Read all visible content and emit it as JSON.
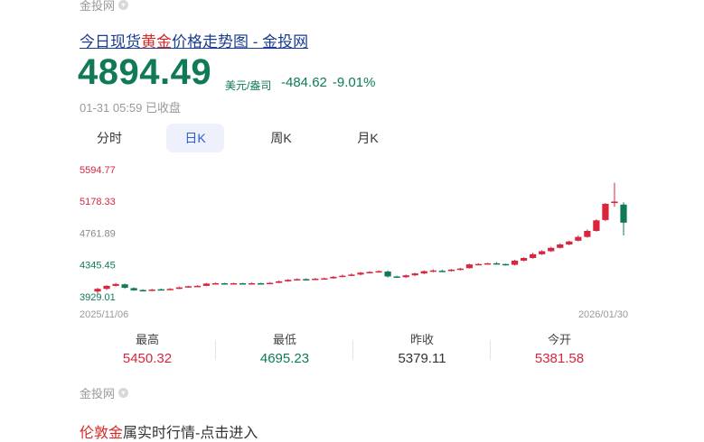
{
  "source": {
    "top": "金投网",
    "bottom": "金投网",
    "icon": "chevron-down-circle-icon"
  },
  "title": {
    "before": "今日现货",
    "highlight": "黄金",
    "after": "价格走势图 - 金投网"
  },
  "quote": {
    "price": "4894.49",
    "unit": "美元/盎司",
    "change": "-484.62",
    "change_pct": "-9.01%",
    "timestamp": "01-31 05:59",
    "status": "已收盘"
  },
  "tabs": [
    {
      "label": "分时"
    },
    {
      "label": "日K",
      "active": true
    },
    {
      "label": "周K"
    },
    {
      "label": "月K"
    }
  ],
  "colors": {
    "up": "#d7263d",
    "down": "#0f7a55",
    "active_tab_bg": "#eef1fb",
    "link": "#1a3d8f"
  },
  "chart_data": {
    "type": "candlestick",
    "y_ticks": [
      "5594.77",
      "5178.33",
      "4761.89",
      "4345.45",
      "3929.01"
    ],
    "x_ticks": [
      "2025/11/06",
      "2026/01/30"
    ],
    "ylim": [
      3929.01,
      5594.77
    ],
    "candles": [
      [
        3975,
        4010,
        3945,
        4025,
        "up"
      ],
      [
        4010,
        4050,
        3995,
        4060,
        "up"
      ],
      [
        4050,
        4075,
        4040,
        4090,
        "up"
      ],
      [
        4070,
        4025,
        4010,
        4080,
        "down"
      ],
      [
        4020,
        3990,
        3985,
        4030,
        "down"
      ],
      [
        3995,
        3985,
        3975,
        4005,
        "down"
      ],
      [
        3985,
        4000,
        3980,
        4010,
        "up"
      ],
      [
        4005,
        3995,
        3990,
        4015,
        "down"
      ],
      [
        4000,
        4010,
        3995,
        4020,
        "up"
      ],
      [
        4010,
        4030,
        4005,
        4040,
        "up"
      ],
      [
        4030,
        4045,
        4025,
        4050,
        "up"
      ],
      [
        4045,
        4050,
        4040,
        4060,
        "up"
      ],
      [
        4050,
        4080,
        4045,
        4090,
        "up"
      ],
      [
        4080,
        4085,
        4070,
        4095,
        "up"
      ],
      [
        4085,
        4080,
        4075,
        4090,
        "down"
      ],
      [
        4080,
        4085,
        4075,
        4092,
        "up"
      ],
      [
        4085,
        4080,
        4070,
        4090,
        "down"
      ],
      [
        4080,
        4085,
        4075,
        4095,
        "up"
      ],
      [
        4085,
        4080,
        4075,
        4090,
        "down"
      ],
      [
        4080,
        4090,
        4075,
        4100,
        "up"
      ],
      [
        4090,
        4110,
        4085,
        4120,
        "up"
      ],
      [
        4110,
        4130,
        4105,
        4140,
        "up"
      ],
      [
        4130,
        4140,
        4120,
        4150,
        "up"
      ],
      [
        4140,
        4135,
        4125,
        4150,
        "down"
      ],
      [
        4135,
        4145,
        4130,
        4155,
        "up"
      ],
      [
        4145,
        4150,
        4140,
        4160,
        "up"
      ],
      [
        4150,
        4170,
        4145,
        4180,
        "up"
      ],
      [
        4170,
        4185,
        4165,
        4200,
        "up"
      ],
      [
        4185,
        4200,
        4180,
        4215,
        "up"
      ],
      [
        4200,
        4225,
        4190,
        4235,
        "up"
      ],
      [
        4225,
        4235,
        4215,
        4245,
        "up"
      ],
      [
        4235,
        4245,
        4225,
        4255,
        "up"
      ],
      [
        4240,
        4175,
        4160,
        4255,
        "down"
      ],
      [
        4175,
        4165,
        4155,
        4185,
        "down"
      ],
      [
        4165,
        4190,
        4155,
        4200,
        "up"
      ],
      [
        4190,
        4215,
        4180,
        4225,
        "up"
      ],
      [
        4215,
        4245,
        4205,
        4255,
        "up"
      ],
      [
        4245,
        4255,
        4230,
        4270,
        "up"
      ],
      [
        4250,
        4245,
        4235,
        4265,
        "down"
      ],
      [
        4250,
        4265,
        4240,
        4275,
        "up"
      ],
      [
        4265,
        4280,
        4255,
        4290,
        "up"
      ],
      [
        4285,
        4335,
        4280,
        4345,
        "up"
      ],
      [
        4335,
        4340,
        4325,
        4350,
        "up"
      ],
      [
        4340,
        4350,
        4330,
        4355,
        "up"
      ],
      [
        4350,
        4345,
        4335,
        4365,
        "down"
      ],
      [
        4340,
        4325,
        4320,
        4345,
        "down"
      ],
      [
        4330,
        4385,
        4320,
        4395,
        "up"
      ],
      [
        4385,
        4420,
        4375,
        4430,
        "up"
      ],
      [
        4420,
        4470,
        4410,
        4490,
        "up"
      ],
      [
        4470,
        4510,
        4460,
        4525,
        "up"
      ],
      [
        4510,
        4555,
        4500,
        4570,
        "up"
      ],
      [
        4555,
        4600,
        4545,
        4615,
        "up"
      ],
      [
        4600,
        4640,
        4590,
        4650,
        "up"
      ],
      [
        4650,
        4700,
        4640,
        4720,
        "up"
      ],
      [
        4700,
        4780,
        4690,
        4800,
        "up"
      ],
      [
        4780,
        4920,
        4770,
        4935,
        "up"
      ],
      [
        4925,
        5140,
        4910,
        5150,
        "up"
      ],
      [
        5150,
        5170,
        5100,
        5420,
        "up"
      ],
      [
        5130,
        4890,
        4720,
        5160,
        "down"
      ]
    ]
  },
  "stats": [
    {
      "label": "最高",
      "value": "5450.32",
      "tone": "up"
    },
    {
      "label": "最低",
      "value": "4695.23",
      "tone": "down"
    },
    {
      "label": "昨收",
      "value": "5379.11",
      "tone": "neutral"
    },
    {
      "label": "今开",
      "value": "5381.58",
      "tone": "up"
    }
  ],
  "link": {
    "highlight": "伦敦金",
    "rest": "属实时行情-点击进入"
  }
}
